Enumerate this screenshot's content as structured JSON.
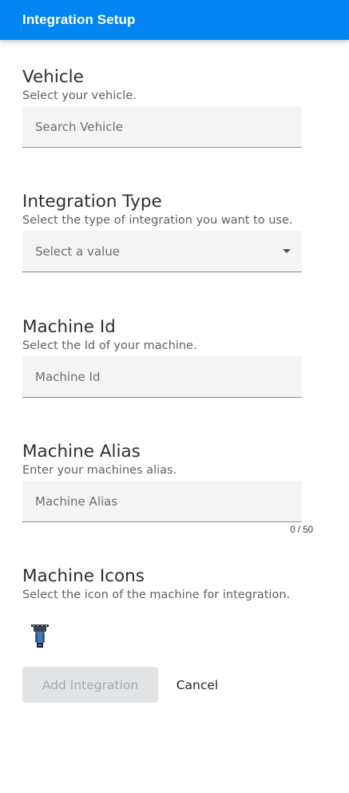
{
  "header": {
    "title": "Integration Setup"
  },
  "vehicle": {
    "title": "Vehicle",
    "description": "Select your vehicle.",
    "placeholder": "Search Vehicle"
  },
  "integration_type": {
    "title": "Integration Type",
    "description": "Select the type of integration you want to use.",
    "placeholder": "Select a value"
  },
  "machine_id": {
    "title": "Machine Id",
    "description": "Select the Id of your machine.",
    "placeholder": "Machine Id"
  },
  "machine_alias": {
    "title": "Machine Alias",
    "description": "Enter your machines alias.",
    "placeholder": "Machine Alias",
    "counter": "0 / 50"
  },
  "machine_icons": {
    "title": "Machine Icons",
    "description": "Select the icon of the machine for integration.",
    "icon": "machine-attachment-icon"
  },
  "actions": {
    "add_label": "Add Integration",
    "cancel_label": "Cancel"
  },
  "colors": {
    "primary": "#0285f3",
    "field_bg": "#f4f4f4",
    "disabled_bg": "#e1e3e5"
  }
}
